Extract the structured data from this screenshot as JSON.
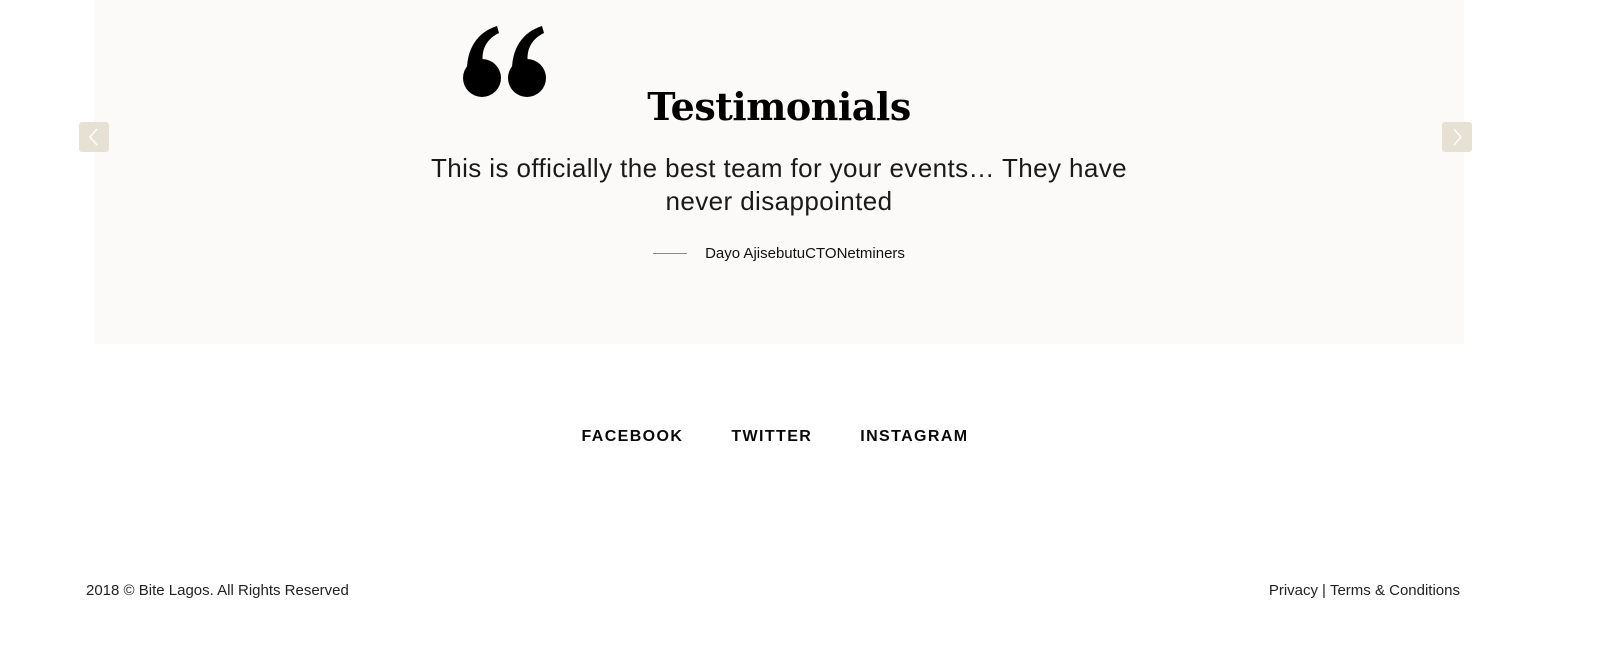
{
  "testimonials": {
    "title": "Testimonials",
    "quote": "This is officially the best team for your events… They have never disappointed",
    "author": {
      "name": "Dayo Ajisebutu",
      "title": "CTO",
      "company": "Netminers"
    },
    "prev_icon": "chevron-left-icon",
    "next_icon": "chevron-right-icon",
    "quote_icon": "quote-mark-icon"
  },
  "social": {
    "links": [
      "FACEBOOK",
      "TWITTER",
      "INSTAGRAM"
    ]
  },
  "footer": {
    "copyright": "2018 © Bite Lagos. All Rights Reserved",
    "privacy": "Privacy",
    "separator": "|",
    "terms": "Terms & Conditions"
  },
  "colors": {
    "panel_bg": "#fbfaf8",
    "nav_button_bg": "#e6e1d3",
    "text": "#111111"
  }
}
